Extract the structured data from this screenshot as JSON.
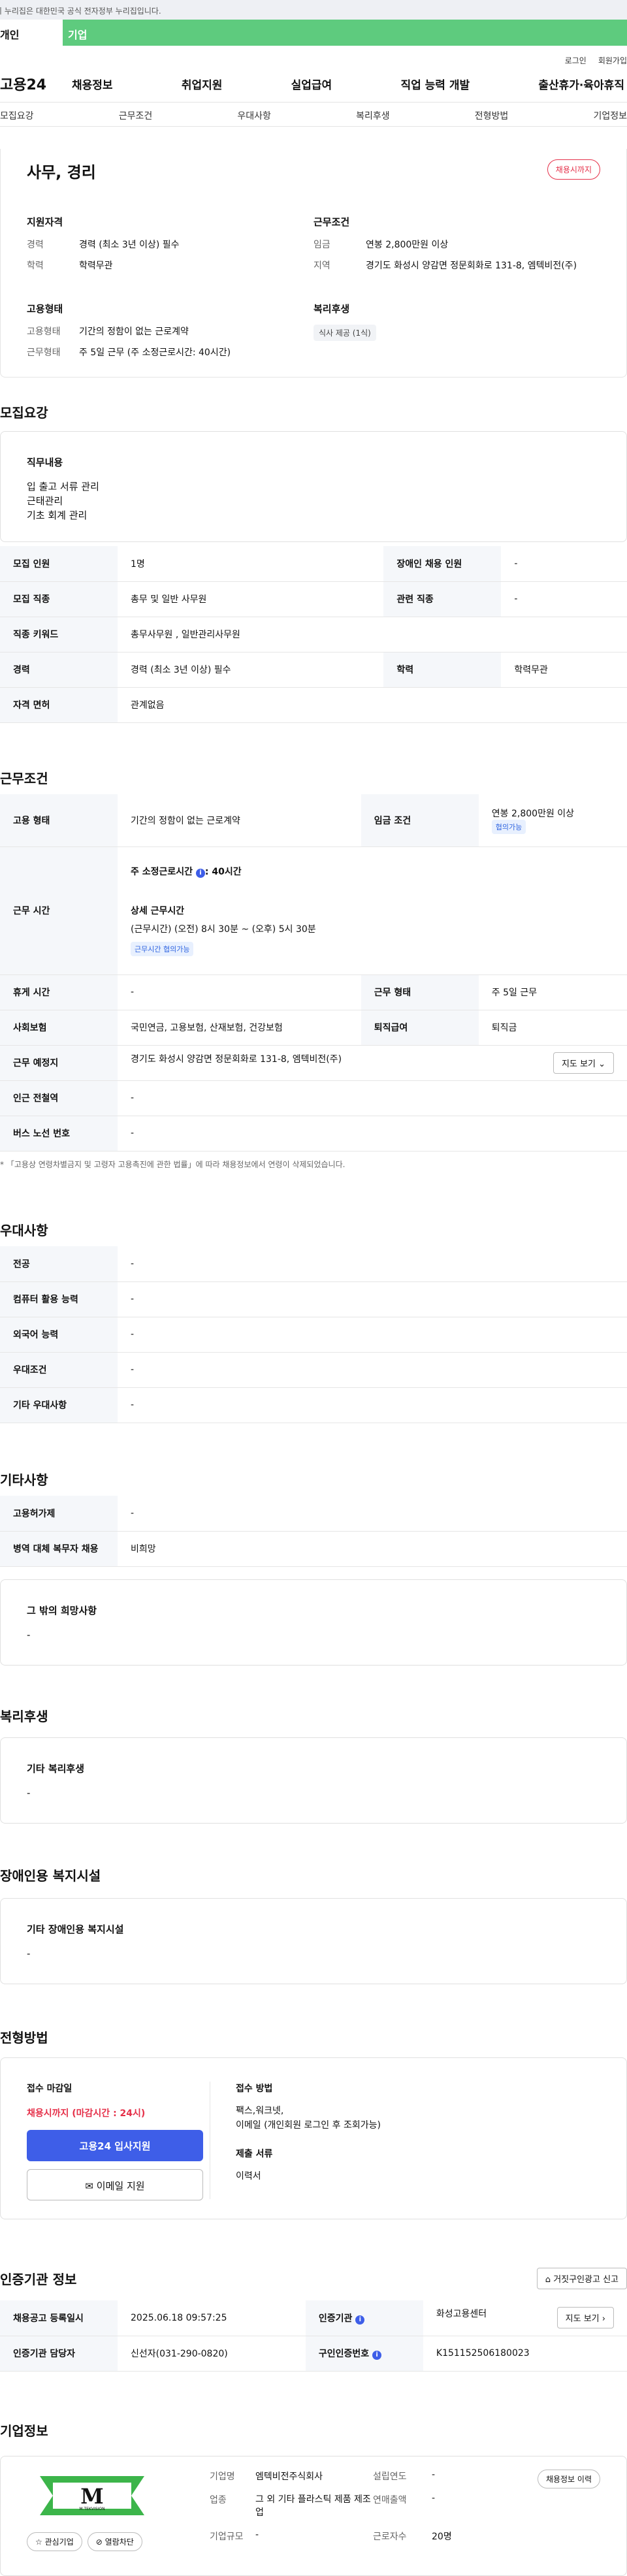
{
  "gov_banner": "이 누리집은 대한민국 공식 전자정부 누리집입니다.",
  "tabs": {
    "personal": "개인",
    "company": "기업"
  },
  "util": {
    "login": "로그인",
    "join": "회원가입"
  },
  "gnb": {
    "logo": "고용24",
    "menu": [
      "채용정보",
      "취업지원",
      "실업급여",
      "직업 능력 개발",
      "출산휴가·육아휴직"
    ]
  },
  "subnav": [
    "모집요강",
    "근무조건",
    "우대사항",
    "복리후생",
    "전형방법",
    "기업정보"
  ],
  "summary": {
    "title": "사무, 경리",
    "status_badge": "채용시까지",
    "qualification": {
      "heading": "지원자격",
      "rows": [
        {
          "k": "경력",
          "v": "경력 (최소 3년 이상) 필수"
        },
        {
          "k": "학력",
          "v": "학력무관"
        }
      ]
    },
    "conditions": {
      "heading": "근무조건",
      "rows": [
        {
          "k": "임금",
          "v": "연봉 2,800만원 이상"
        },
        {
          "k": "지역",
          "v": "경기도 화성시 양감면 정문회화로 131-8, 엠텍비전(주)"
        }
      ]
    },
    "employment": {
      "heading": "고용형태",
      "rows": [
        {
          "k": "고용형태",
          "v": "기간의 정함이 없는 근로계약"
        },
        {
          "k": "근무형태",
          "v": "주 5일 근무 (주 소정근로시간: 40시간)"
        }
      ]
    },
    "welfare": {
      "heading": "복리후생",
      "chip": "식사 제공 (1식)"
    }
  },
  "recruit": {
    "title": "모집요강",
    "duty_heading": "직무내용",
    "duty_lines": [
      "입 출고 서류 관리",
      "근태관리",
      "기초 회계 관리"
    ],
    "table": [
      [
        "모집 인원",
        "1명",
        "장애인 채용 인원",
        "-"
      ],
      [
        "모집 직종",
        "총무 및 일반 사무원",
        "관련 직종",
        "-"
      ],
      [
        "직종 키워드",
        "총무사무원 , 일반관리사무원"
      ],
      [
        "경력",
        "경력 (최소 3년 이상) 필수",
        "학력",
        "학력무관"
      ],
      [
        "자격 면허",
        "관계없음"
      ]
    ]
  },
  "work": {
    "title": "근무조건",
    "employment_label": "고용 형태",
    "employment_value": "기간의 정함이 없는 근로계약",
    "wage_label": "임금 조건",
    "wage_value": "연봉 2,800만원 이상",
    "wage_tag": "협의가능",
    "hours_label": "근무 시간",
    "hours_weekly": "주 소정근로시간",
    "hours_weekly_value": ": 40시간",
    "hours_detail_title": "상세 근무시간",
    "hours_detail": "(근무시간) (오전) 8시 30분 ~ (오후) 5시 30분",
    "hours_tag": "근무시간 협의가능",
    "rest_label": "휴게 시간",
    "rest_value": "-",
    "form_label": "근무 형태",
    "form_value": "주 5일 근무",
    "insurance_label": "사회보험",
    "insurance_value": "국민연금, 고용보험, 산재보험, 건강보험",
    "severance_label": "퇴직급여",
    "severance_value": "퇴직금",
    "place_label": "근무 예정지",
    "place_value": "경기도 화성시 양감면 정문회화로 131-8, 엠텍비전(주)",
    "map_btn": "지도 보기",
    "subway_label": "인근 전철역",
    "subway_value": "-",
    "bus_label": "버스 노선 번호",
    "bus_value": "-",
    "note": "* 「고용상 연령차별금지 및 고령자 고용촉진에 관한 법률」에 따라 채용정보에서 연령이 삭제되었습니다."
  },
  "preference": {
    "title": "우대사항",
    "rows": [
      [
        "전공",
        "-"
      ],
      [
        "컴퓨터 활용 능력",
        "-"
      ],
      [
        "외국어 능력",
        "-"
      ],
      [
        "우대조건",
        "-"
      ],
      [
        "기타 우대사항",
        "-"
      ]
    ]
  },
  "etc": {
    "title": "기타사항",
    "rows": [
      [
        "고용허가제",
        "-"
      ],
      [
        "병역 대체 복무자 채용",
        "비희망"
      ]
    ],
    "other_heading": "그 밖의 희망사항",
    "other_value": "-"
  },
  "benefits": {
    "title": "복리후생",
    "heading": "기타 복리후생",
    "value": "-"
  },
  "disability": {
    "title": "장애인용 복지시설",
    "heading": "기타 장애인용 복지시설",
    "value": "-"
  },
  "process": {
    "title": "전형방법",
    "deadline_label": "접수 마감일",
    "deadline_value": "채용시까지 (마감시간 : 24시)",
    "apply_btn": "고용24 입사지원",
    "email_btn": "이메일 지원",
    "method_label": "접수 방법",
    "method_value": "팩스,워크넷,",
    "method_value2": "이메일 (개인회원 로그인 후 조회가능)",
    "docs_label": "제출 서류",
    "docs_value": "이력서"
  },
  "cert": {
    "title": "인증기관 정보",
    "report_btn": "거짓구인광고 신고",
    "rows": [
      [
        "채용공고 등록일시",
        "2025.06.18 09:57:25",
        "인증기관",
        "화성고용센터"
      ],
      [
        "인증기관 담당자",
        "신선자(031-290-0820)",
        "구인인증번호",
        "K151152506180023"
      ]
    ],
    "map_btn": "지도 보기"
  },
  "company": {
    "title": "기업정보",
    "logo_text": "M.TEKVISION",
    "interest_btn": "관심기업",
    "block_btn": "열람차단",
    "history_btn": "채용정보 이력",
    "rows": [
      [
        "기업명",
        "엠텍비전주식회사",
        "설립연도",
        "-"
      ],
      [
        "업종",
        "그 외 기타 플라스틱 제품 제조업",
        "연매출액",
        "-"
      ],
      [
        "기업규모",
        "-",
        "근로자수",
        "20명"
      ]
    ]
  }
}
